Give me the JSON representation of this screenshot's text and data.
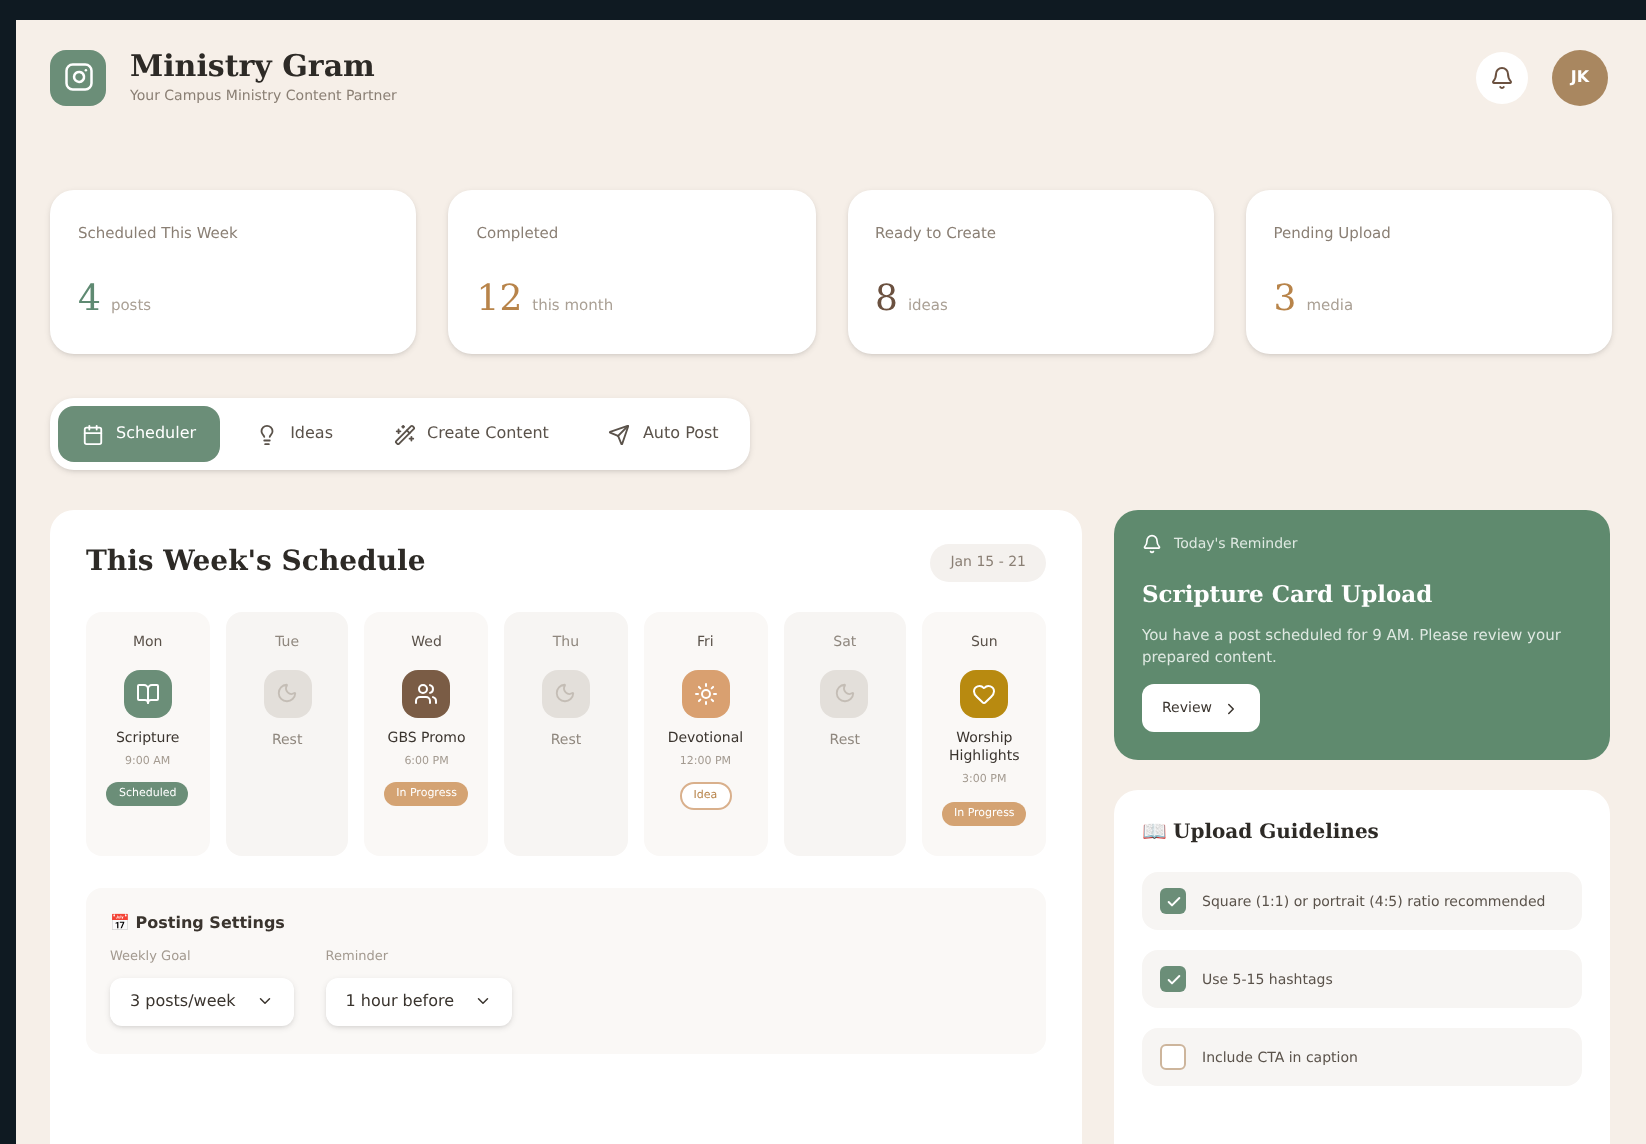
{
  "header": {
    "title": "Ministry Gram",
    "subtitle": "Your Campus Ministry Content Partner",
    "avatar": "JK"
  },
  "stats": [
    {
      "label": "Scheduled This Week",
      "value": "4",
      "unit": "posts",
      "color": "#5f8a72"
    },
    {
      "label": "Completed",
      "value": "12",
      "unit": "this month",
      "color": "#b8844a"
    },
    {
      "label": "Ready to Create",
      "value": "8",
      "unit": "ideas",
      "color": "#6b5140"
    },
    {
      "label": "Pending Upload",
      "value": "3",
      "unit": "media",
      "color": "#b8844a"
    }
  ],
  "tabs": [
    {
      "label": "Scheduler",
      "selected": true
    },
    {
      "label": "Ideas",
      "selected": false
    },
    {
      "label": "Create Content",
      "selected": false
    },
    {
      "label": "Auto Post",
      "selected": false
    }
  ],
  "schedule": {
    "title": "This Week's Schedule",
    "range": "Jan 15 - 21",
    "days": [
      {
        "day": "Mon",
        "kind": "post",
        "title": "Scripture",
        "time": "9:00 AM",
        "status": {
          "text": "Scheduled",
          "kind": "filled",
          "color": "#6b8e78"
        },
        "color": "#6b8e78"
      },
      {
        "day": "Tue",
        "kind": "rest",
        "title": "Rest"
      },
      {
        "day": "Wed",
        "kind": "post",
        "title": "GBS Promo",
        "time": "6:00 PM",
        "status": {
          "text": "In Progress",
          "kind": "filled",
          "color": "#d4a373"
        },
        "color": "#7a5c45"
      },
      {
        "day": "Thu",
        "kind": "rest",
        "title": "Rest"
      },
      {
        "day": "Fri",
        "kind": "post",
        "title": "Devotional",
        "time": "12:00 PM",
        "status": {
          "text": "Idea",
          "kind": "outline",
          "color": "#d9b08c"
        },
        "color": "#d9a070"
      },
      {
        "day": "Sat",
        "kind": "rest",
        "title": "Rest"
      },
      {
        "day": "Sun",
        "kind": "post",
        "title": "Worship Highlights",
        "time": "3:00 PM",
        "status": {
          "text": "In Progress",
          "kind": "filled",
          "color": "#d4a373"
        },
        "color": "#b88a10"
      }
    ]
  },
  "settings": {
    "title": "📅 Posting Settings",
    "fields": [
      {
        "label": "Weekly Goal",
        "value": "3 posts/week"
      },
      {
        "label": "Reminder",
        "value": "1 hour before"
      }
    ]
  },
  "reminder": {
    "label": "Today's Reminder",
    "title": "Scripture Card Upload",
    "text": "You have a post scheduled for 9 AM. Please review your prepared content.",
    "button": "Review"
  },
  "guidelines": {
    "title": "📖 Upload Guidelines",
    "items": [
      {
        "label": "Square (1:1) or portrait (4:5) ratio recommended",
        "checked": true
      },
      {
        "label": "Use 5-15 hashtags",
        "checked": true
      },
      {
        "label": "Include CTA in caption",
        "checked": false
      }
    ]
  }
}
